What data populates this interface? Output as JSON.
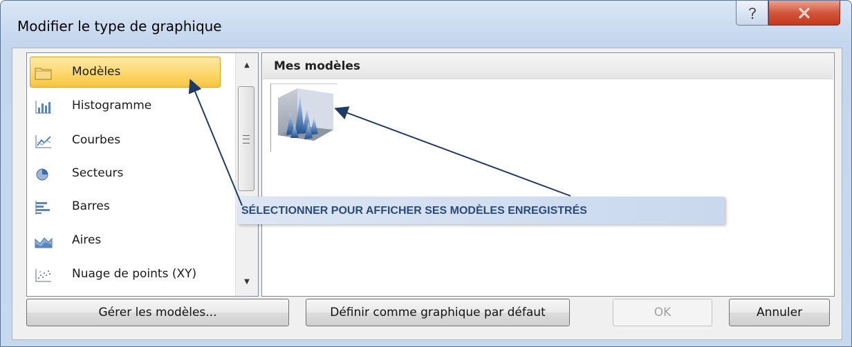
{
  "window": {
    "title": "Modifier le type de graphique"
  },
  "titlebar": {
    "help_glyph": "?",
    "close_glyph": "✕"
  },
  "sidebar": {
    "items": [
      {
        "label": "Modèles",
        "icon": "folder-icon",
        "selected": true
      },
      {
        "label": "Histogramme",
        "icon": "column-chart-icon"
      },
      {
        "label": "Courbes",
        "icon": "line-chart-icon"
      },
      {
        "label": "Secteurs",
        "icon": "pie-chart-icon"
      },
      {
        "label": "Barres",
        "icon": "bar-chart-icon"
      },
      {
        "label": "Aires",
        "icon": "area-chart-icon"
      },
      {
        "label": "Nuage de points (XY)",
        "icon": "scatter-chart-icon"
      }
    ]
  },
  "main": {
    "section_title": "Mes modèles",
    "templates": [
      {
        "icon": "surface-3d-chart-icon"
      }
    ]
  },
  "annotation": {
    "text": "SÉLECTIONNER POUR AFFICHER SES MODÈLES ENREGISTRÉS"
  },
  "buttons": {
    "manage": "Gérer les modèles...",
    "set_default": "Définir comme graphique par défaut",
    "ok": "OK",
    "cancel": "Annuler"
  },
  "colors": {
    "selected_item": "#fcd667",
    "annotation_text": "#2a4a7a",
    "arrow": "#1f3a64",
    "close_button": "#c4371c"
  }
}
